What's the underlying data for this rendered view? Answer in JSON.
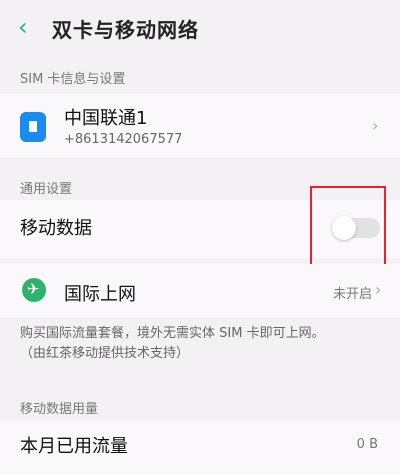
{
  "header": {
    "back_icon": "chevron-left-icon",
    "title": "双卡与移动网络"
  },
  "sim_section": {
    "label": "SIM 卡信息与设置",
    "sim": {
      "icon": "sim-card-icon",
      "name": "中国联通1",
      "number": "+8613142067577"
    }
  },
  "general_section": {
    "label": "通用设置",
    "mobile_data": {
      "label": "移动数据",
      "enabled": false
    }
  },
  "international": {
    "icon": "airplane-globe-icon",
    "label": "国际上网",
    "status": "未开启",
    "desc_line1": "购买国际流量套餐，境外无需实体 SIM 卡即可上网。",
    "desc_line2": "（由红茶移动提供技术支持）"
  },
  "usage_section": {
    "label": "移动数据用量",
    "month_usage": {
      "label": "本月已用流量",
      "value": "0 B"
    }
  },
  "colors": {
    "accent": "#2aa596",
    "sim_icon": "#1c8bf0",
    "intl_icon": "#2db36d",
    "highlight": "#e8212d"
  }
}
